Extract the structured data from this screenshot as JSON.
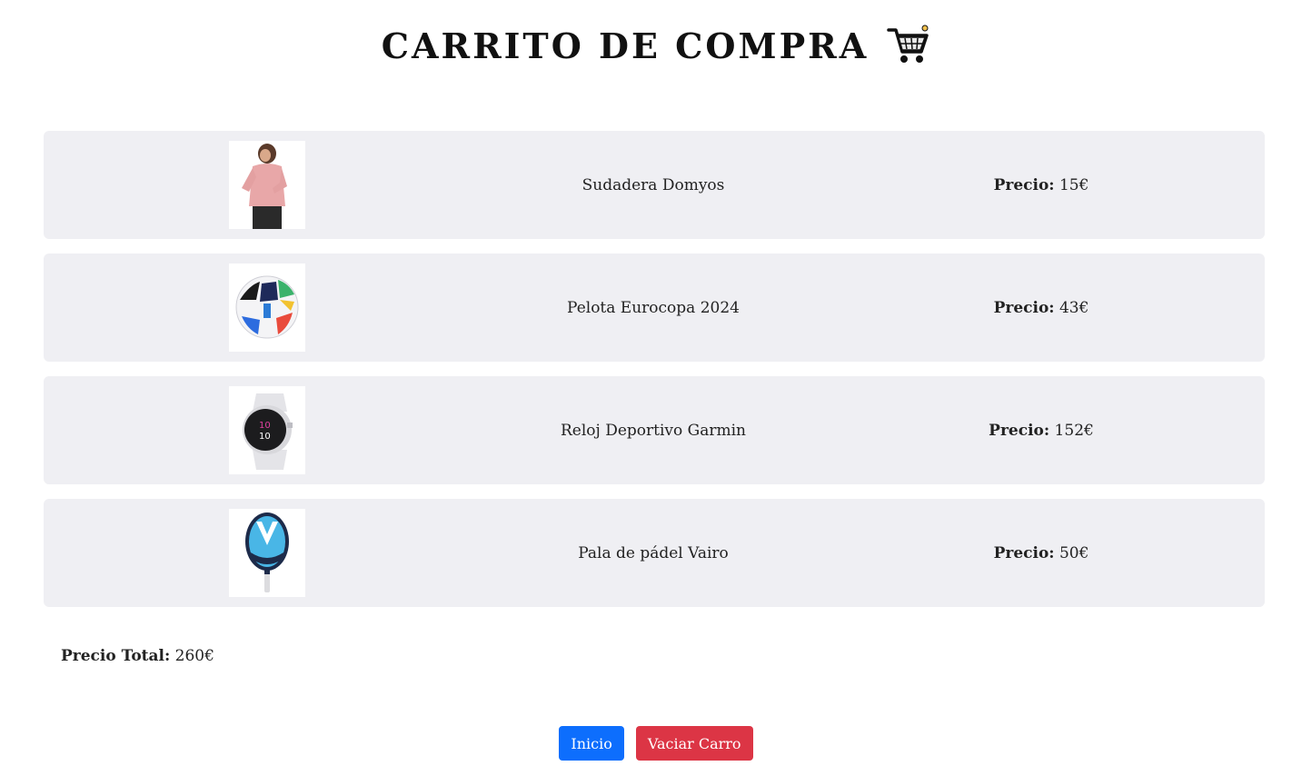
{
  "header": {
    "title": "CARRITO DE COMPRA",
    "icon": "shopping-cart-icon"
  },
  "items": [
    {
      "name": "Sudadera Domyos",
      "price_label": "Precio:",
      "price_value": " 15€",
      "image": "pink-sweatshirt"
    },
    {
      "name": "Pelota Eurocopa 2024",
      "price_label": "Precio:",
      "price_value": " 43€",
      "image": "soccer-ball"
    },
    {
      "name": "Reloj Deportivo Garmin",
      "price_label": "Precio:",
      "price_value": " 152€",
      "image": "sport-watch"
    },
    {
      "name": "Pala de pádel Vairo",
      "price_label": "Precio:",
      "price_value": " 50€",
      "image": "padel-racket"
    }
  ],
  "total": {
    "label": "Precio Total:",
    "value": " 260€"
  },
  "actions": {
    "home_label": "Inicio",
    "empty_label": "Vaciar Carro"
  },
  "colors": {
    "row_background": "#efeff3",
    "primary": "#0d6efd",
    "danger": "#dc3545"
  }
}
